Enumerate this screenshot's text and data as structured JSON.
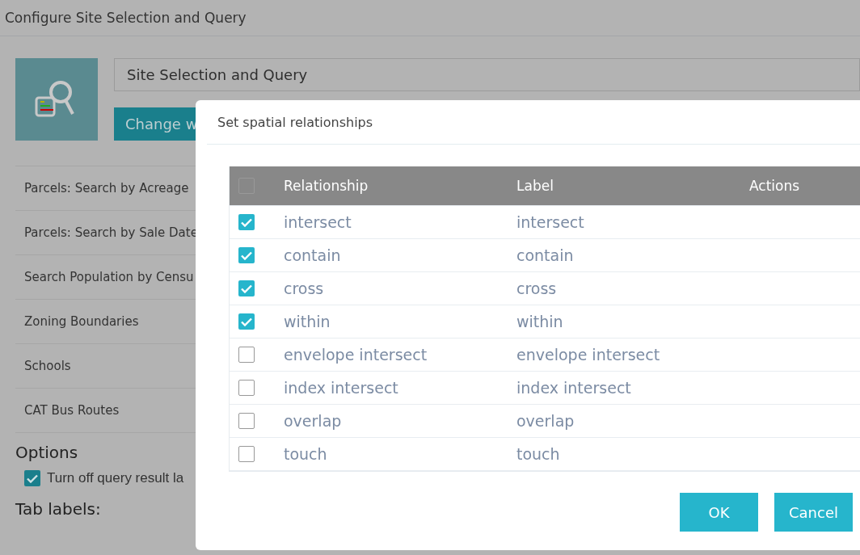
{
  "window": {
    "title": "Configure Site Selection and Query"
  },
  "widget": {
    "name": "Site Selection and Query",
    "change_button": "Change w"
  },
  "layers": [
    {
      "label": "Parcels: Search by Acreage"
    },
    {
      "label": "Parcels: Search by Sale Date"
    },
    {
      "label": "Search Population by Censu"
    },
    {
      "label": "Zoning Boundaries"
    },
    {
      "label": "Schools"
    },
    {
      "label": "CAT Bus Routes"
    }
  ],
  "options": {
    "heading": "Options",
    "checkbox": {
      "label": "Turn off query result la",
      "checked": true
    }
  },
  "tab_labels": {
    "heading": "Tab labels:"
  },
  "dialog": {
    "title": "Set spatial relationships",
    "table": {
      "select_all": {
        "checked": false
      },
      "columns": [
        "Relationship",
        "Label",
        "Actions"
      ],
      "rows": [
        {
          "relationship": "intersect",
          "label": "intersect",
          "checked": true
        },
        {
          "relationship": "contain",
          "label": "contain",
          "checked": true
        },
        {
          "relationship": "cross",
          "label": "cross",
          "checked": true
        },
        {
          "relationship": "within",
          "label": "within",
          "checked": true
        },
        {
          "relationship": "envelope intersect",
          "label": "envelope intersect",
          "checked": false
        },
        {
          "relationship": "index intersect",
          "label": "index intersect",
          "checked": false
        },
        {
          "relationship": "overlap",
          "label": "overlap",
          "checked": false
        },
        {
          "relationship": "touch",
          "label": "touch",
          "checked": false
        }
      ]
    },
    "buttons": [
      "OK",
      "Cancel"
    ]
  }
}
